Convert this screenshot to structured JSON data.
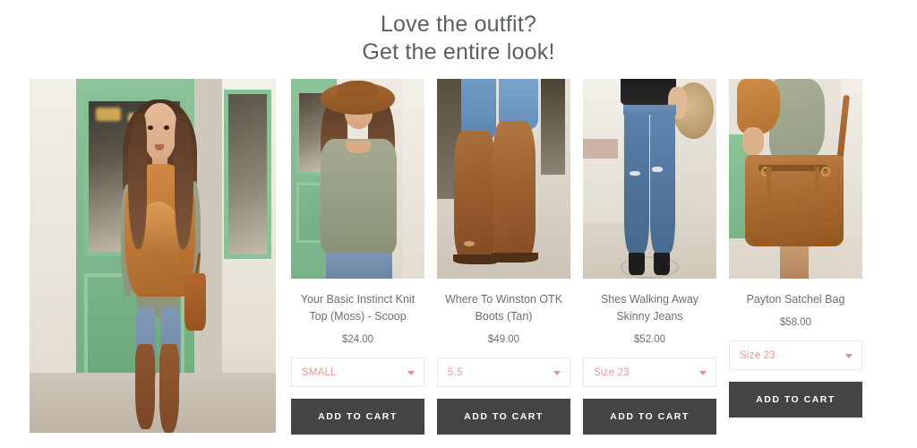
{
  "heading": {
    "line1": "Love the outfit?",
    "line2": "Get the entire look!"
  },
  "hero": {
    "alt": "Model wearing moss knit top, rust blanket scarf, distressed skinny jeans, tan over-the-knee boots and cognac satchel bag in front of a green storefront"
  },
  "colors": {
    "heading_text": "#5b6064",
    "body_text": "#6e6e6e",
    "select_text": "#e79a95",
    "select_border": "#eceaea",
    "button_bg": "#444444",
    "button_text": "#ffffff",
    "page_bg": "#ffffff"
  },
  "products": [
    {
      "title": "Your Basic Instinct Knit Top (Moss) - Scoop",
      "price": "$24.00",
      "size": "SMALL",
      "button_label": "ADD TO CART",
      "image_alt": "Model in olive moss knit top with brown floppy hat"
    },
    {
      "title": "Where To Winston OTK Boots (Tan)",
      "price": "$49.00",
      "size": "5.5",
      "button_label": "ADD TO CART",
      "image_alt": "Tan over-the-knee leather boots worn with blue jeans"
    },
    {
      "title": "Shes Walking Away Skinny Jeans",
      "price": "$52.00",
      "size": "Size 23",
      "button_label": "ADD TO CART",
      "image_alt": "Distressed blue skinny jeans with black top and black heels"
    },
    {
      "title": "Payton Satchel Bag",
      "price": "$58.00",
      "size": "Size 23",
      "button_label": "ADD TO CART",
      "image_alt": "Cognac brown leather satchel bag held at the hip"
    }
  ],
  "icons": {
    "select_chevron": "chevron-down-icon"
  }
}
